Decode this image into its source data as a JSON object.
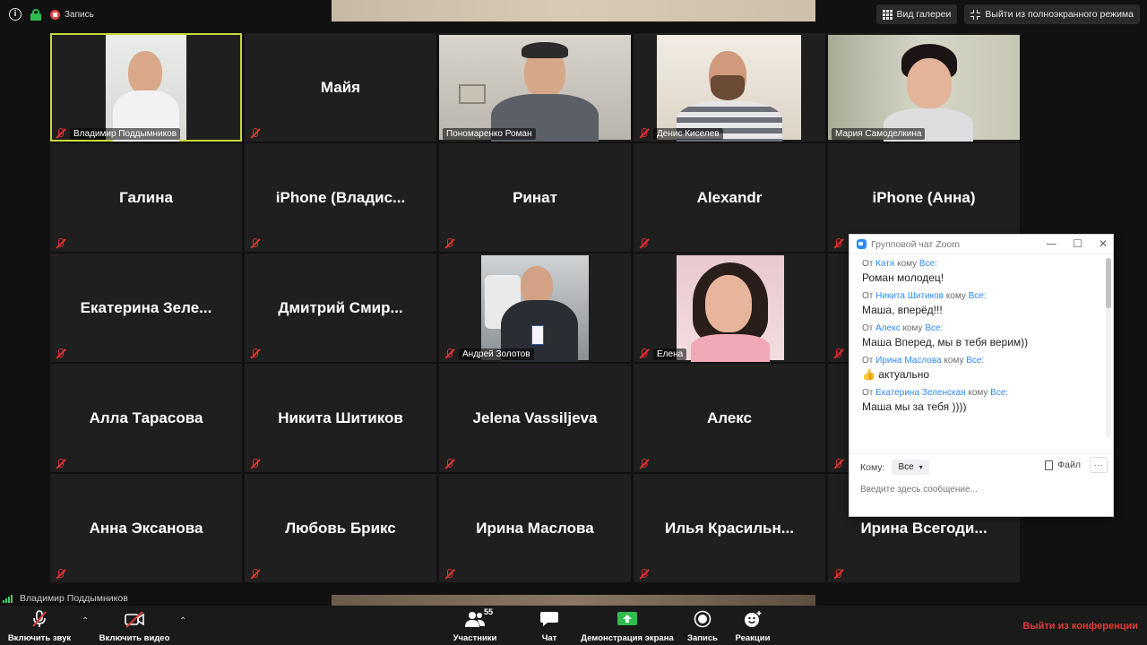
{
  "topbar": {
    "info_icon": "info-icon",
    "security_icon": "lock-icon",
    "record_label": "Запись",
    "gallery_view_label": "Вид галереи",
    "exit_fullscreen_label": "Выйти из полноэкранного режима"
  },
  "tiles": [
    {
      "name": "Владимир Поддымников",
      "type": "video",
      "label": "Владимир Поддымников",
      "active": true
    },
    {
      "name": "Майя",
      "type": "name"
    },
    {
      "name": "Пономаренко Роман",
      "type": "video",
      "label": "Пономаренко Роман"
    },
    {
      "name": "Денис Киселев",
      "type": "video",
      "label": "Денис Киселев"
    },
    {
      "name": "Мария Самоделкина",
      "type": "video",
      "label": "Мария Самоделкина"
    },
    {
      "name": "Галина",
      "type": "name"
    },
    {
      "name": "iPhone  (Владис...",
      "type": "name"
    },
    {
      "name": "Ринат",
      "type": "name"
    },
    {
      "name": "Alexandr",
      "type": "name"
    },
    {
      "name": "iPhone (Анна)",
      "type": "name"
    },
    {
      "name": "Екатерина  Зеле...",
      "type": "name"
    },
    {
      "name": "Дмитрий  Смир...",
      "type": "name"
    },
    {
      "name": "Андрей Золотов",
      "type": "photo",
      "label": "Андрей Золотов"
    },
    {
      "name": "Елена",
      "type": "photo",
      "label": "Елена"
    },
    {
      "name": "",
      "type": "name"
    },
    {
      "name": "Алла Тарасова",
      "type": "name"
    },
    {
      "name": "Никита Шитиков",
      "type": "name"
    },
    {
      "name": "Jelena Vassiljeva",
      "type": "name"
    },
    {
      "name": "Алекс",
      "type": "name"
    },
    {
      "name": "",
      "type": "name"
    },
    {
      "name": "Анна Эксанова",
      "type": "name"
    },
    {
      "name": "Любовь Брикс",
      "type": "name"
    },
    {
      "name": "Ирина Маслова",
      "type": "name"
    },
    {
      "name": "Илья  Красильн...",
      "type": "name"
    },
    {
      "name": "Ирина  Всегоди...",
      "type": "name"
    }
  ],
  "chat": {
    "title": "Групповой чат Zoom",
    "win_min": "—",
    "win_max": "☐",
    "win_close": "✕",
    "from_word": "От",
    "to_word": "кому",
    "messages": [
      {
        "from": "Катя",
        "to": "Все:",
        "text": "Роман молодец!"
      },
      {
        "from": "Никита Шитиков",
        "to": "Все:",
        "text": "Маша, вперёд!!!"
      },
      {
        "from": "Алекс",
        "to": "Все:",
        "text": "Маша Вперед, мы в тебя верим))"
      },
      {
        "from": "Ирина Маслова",
        "to": "Все:",
        "text": "👍 актуально"
      },
      {
        "from": "Екатерина Зеленская ",
        "to": "Все:",
        "text": "Маша мы за тебя ))))"
      }
    ],
    "to_label": "Кому:",
    "to_value": "Все",
    "file_label": "Файл",
    "more_label": "···",
    "input_placeholder": "Введите здесь сообщение..."
  },
  "status": {
    "speaker": "Владимир Поддымников"
  },
  "toolbar": {
    "unmute_label": "Включить звук",
    "start_video_label": "Включить видео",
    "participants_label": "Участники",
    "participants_count": "55",
    "chat_label": "Чат",
    "share_label": "Демонстрация экрана",
    "record_label": "Запись",
    "reactions_label": "Реакции",
    "leave_label": "Выйти из конференции",
    "caret": "⌃"
  },
  "colors": {
    "active_outline": "#c8d93a",
    "mute_red": "#d33333",
    "leave_red": "#e03c3c",
    "share_green": "#2ebd4e",
    "zoom_blue": "#2d8cff"
  }
}
